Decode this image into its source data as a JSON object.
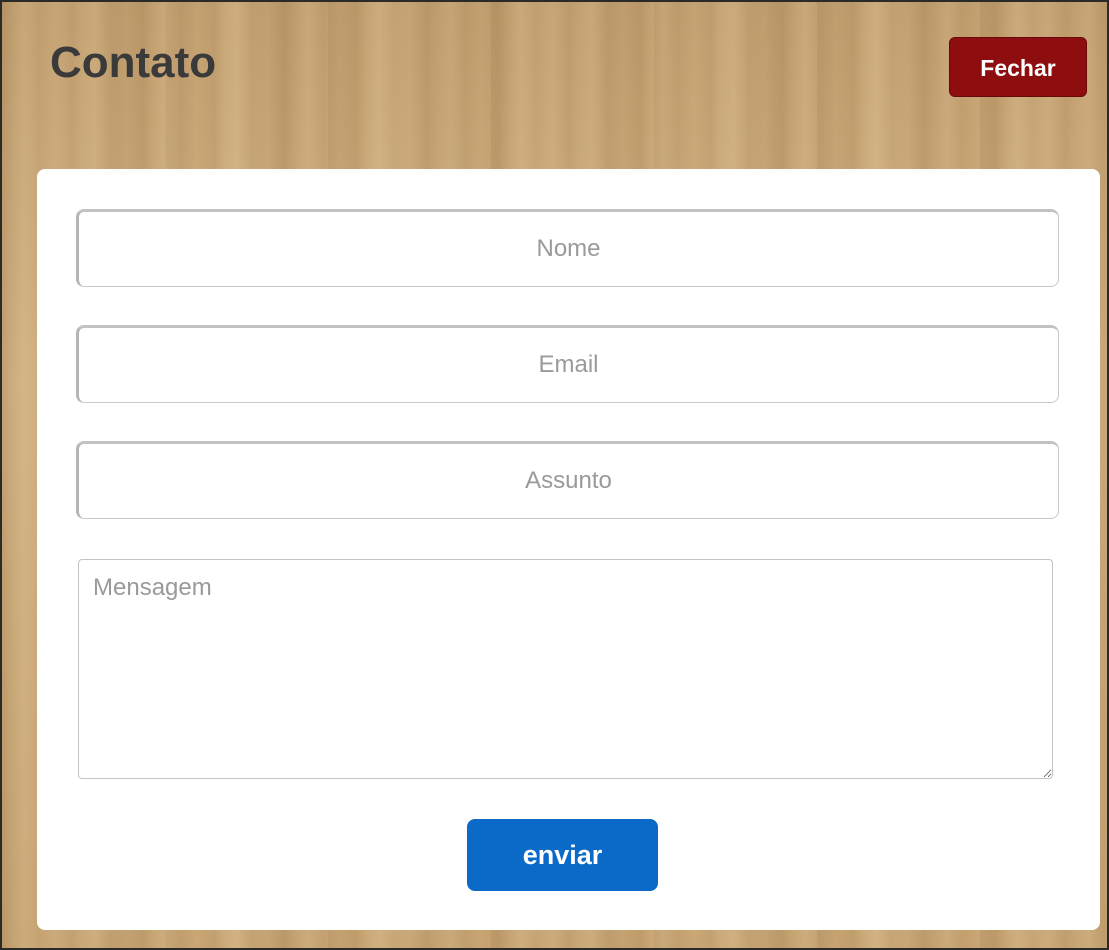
{
  "header": {
    "title": "Contato",
    "close_label": "Fechar"
  },
  "form": {
    "name_placeholder": "Nome",
    "email_placeholder": "Email",
    "subject_placeholder": "Assunto",
    "message_placeholder": "Mensagem",
    "submit_label": "enviar"
  },
  "colors": {
    "close_button": "#8e0d0f",
    "submit_button": "#0b6ac7",
    "title_text": "#3a3a3a",
    "card_background": "#ffffff"
  }
}
